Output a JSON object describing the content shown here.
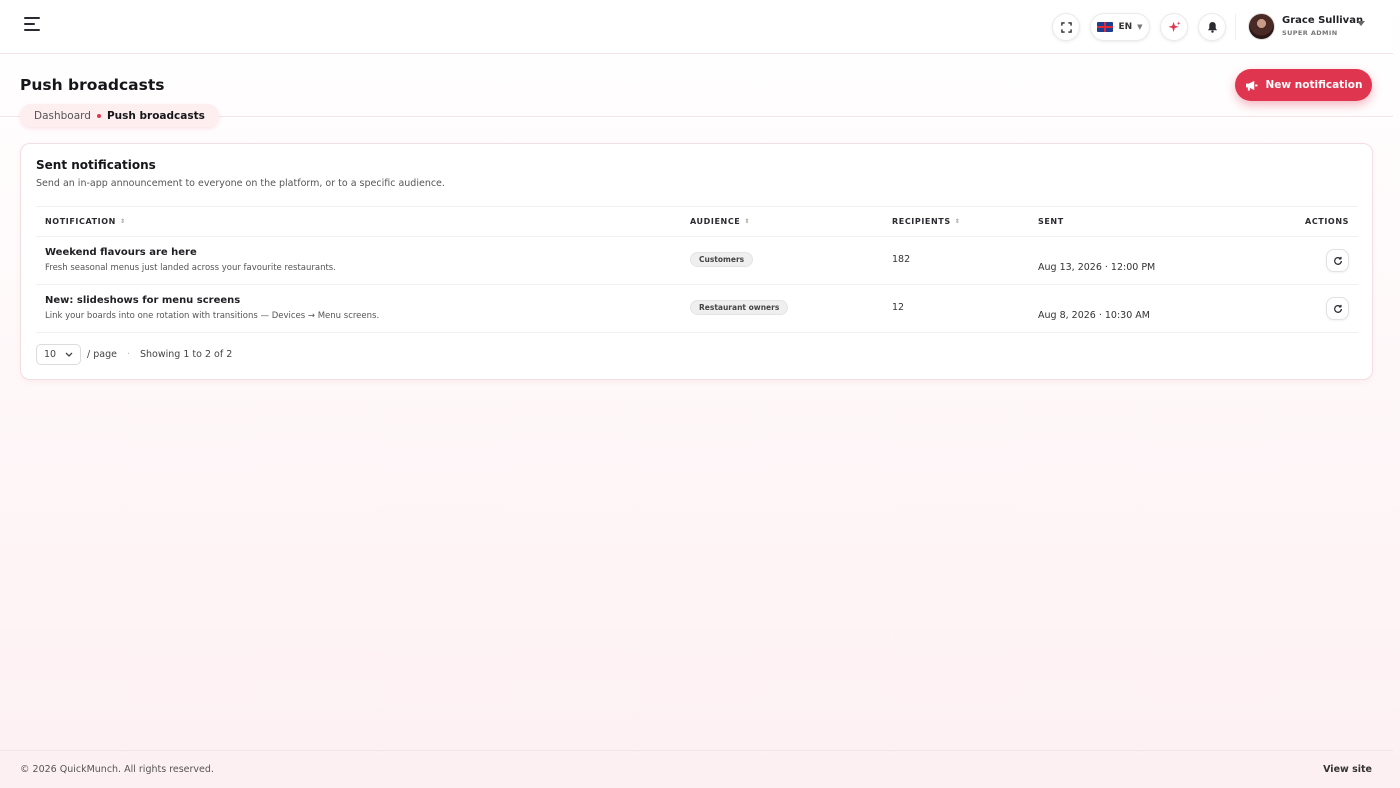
{
  "topbar": {
    "language": "EN",
    "user": {
      "name": "Grace Sullivan",
      "role": "SUPER ADMIN"
    }
  },
  "page": {
    "title": "Push broadcasts",
    "new_button_label": "New notification",
    "breadcrumb": {
      "parent": "Dashboard",
      "current": "Push broadcasts"
    }
  },
  "card": {
    "title": "Sent notifications",
    "subtitle": "Send an in-app announcement to everyone on the platform, or to a specific audience.",
    "columns": {
      "notification": "NOTIFICATION",
      "audience": "AUDIENCE",
      "recipients": "RECIPIENTS",
      "sent": "SENT",
      "actions": "ACTIONS"
    },
    "rows": [
      {
        "title": "Weekend flavours are here",
        "description": "Fresh seasonal menus just landed across your favourite restaurants.",
        "audience": "Customers",
        "recipients": "182",
        "sent": "Aug 13, 2026 · 12:00 PM"
      },
      {
        "title": "New: slideshows for menu screens",
        "description": "Link your boards into one rotation with transitions — Devices → Menu screens.",
        "audience": "Restaurant owners",
        "recipients": "12",
        "sent": "Aug 8, 2026 · 10:30 AM"
      }
    ],
    "pagination": {
      "page_size": "10",
      "per_page_label": "/ page",
      "showing": "Showing 1 to 2 of 2"
    }
  },
  "footer": {
    "copyright": "© 2026 QuickMunch. All rights reserved.",
    "view_site": "View site"
  },
  "colors": {
    "accent": "#e0354f",
    "accent_soft": "#fdeef0"
  },
  "icons": [
    "menu-icon",
    "fullscreen-icon",
    "uk-flag-icon",
    "sparkle-icon",
    "bell-icon",
    "megaphone-icon",
    "refresh-icon",
    "chevron-down-icon"
  ]
}
